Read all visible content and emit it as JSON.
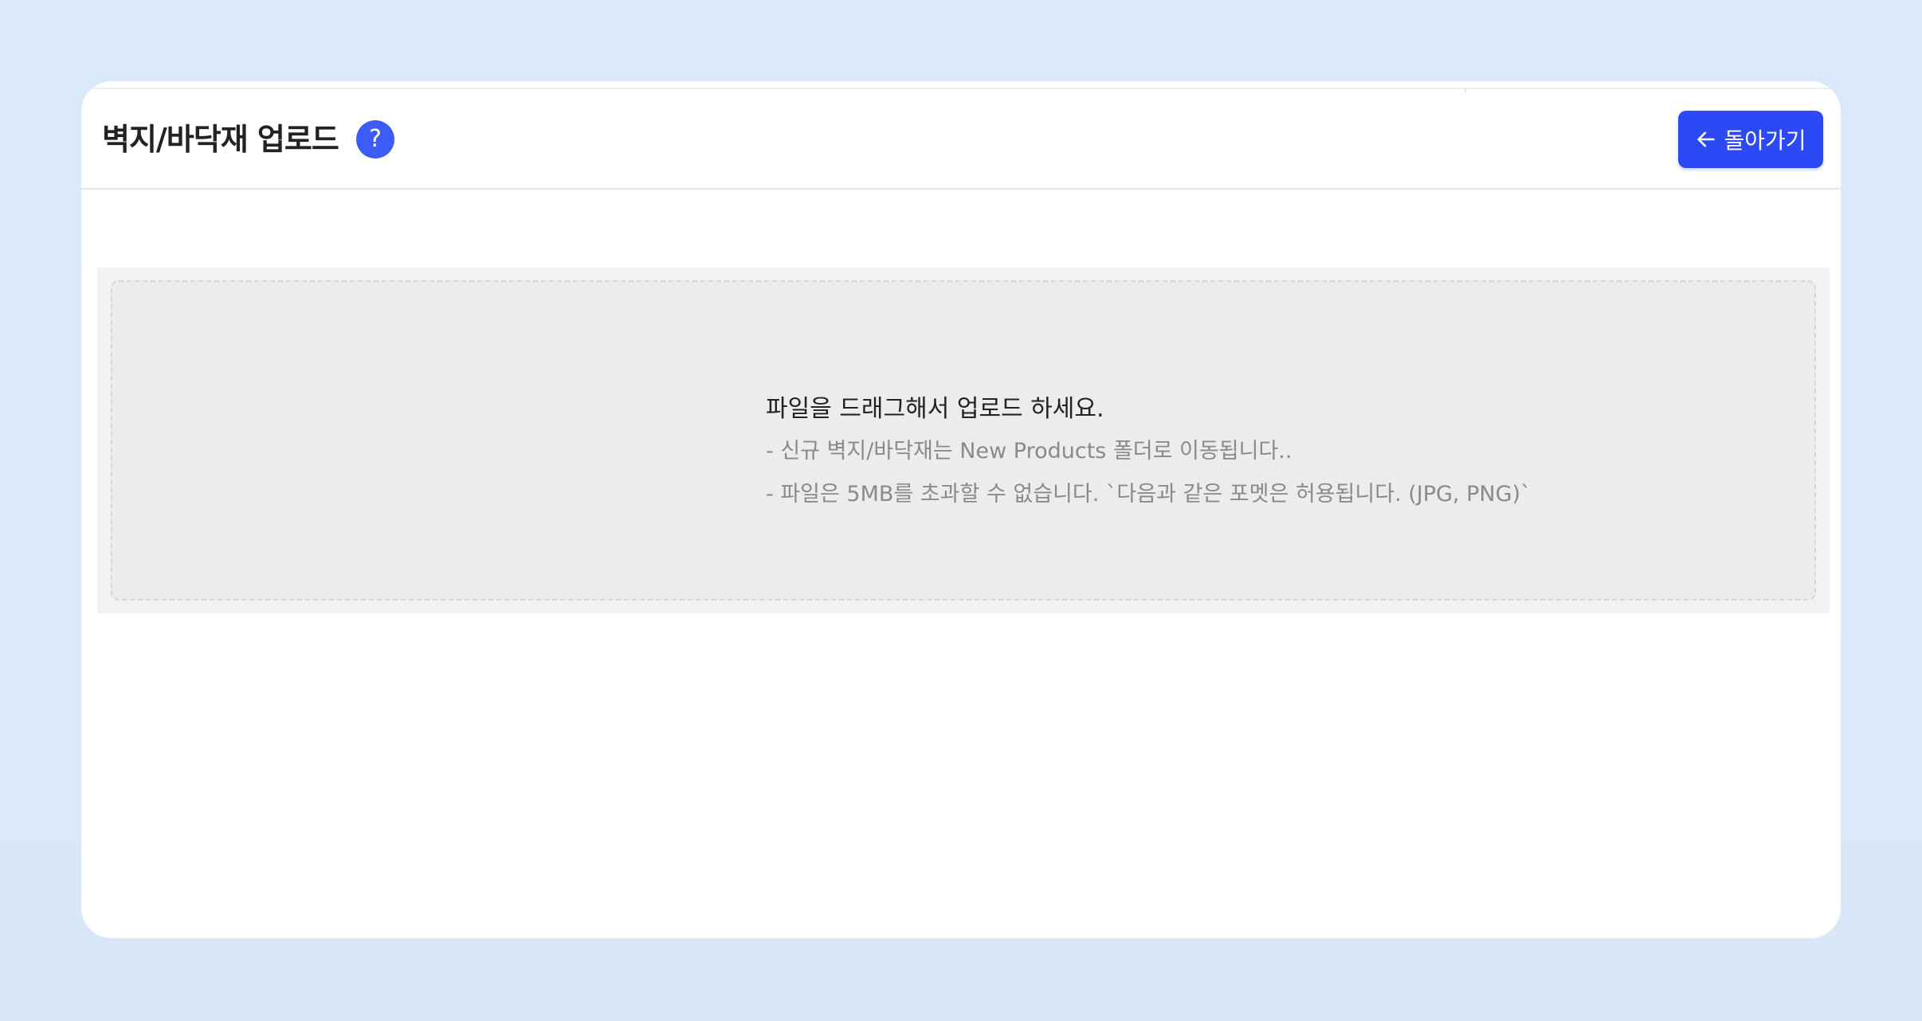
{
  "header": {
    "title": "벽지/바닥재 업로드",
    "help_label": "?",
    "back_label": "돌아가기"
  },
  "upload": {
    "title": "파일을 드래그해서 업로드 하세요.",
    "notes": [
      "- 신규 벽지/바닥재는 New Products 폴더로 이동됩니다..",
      "- 파일은 5MB를 초과할 수 없습니다. `다음과 같은 포멧은 허용됩니다. (JPG, PNG)`"
    ]
  },
  "colors": {
    "accent": "#2c49f6",
    "help_badge": "#3d5bf5",
    "background": "#dbe9fa"
  },
  "icons": {
    "help": "question-mark-icon",
    "back": "arrow-left-icon"
  }
}
